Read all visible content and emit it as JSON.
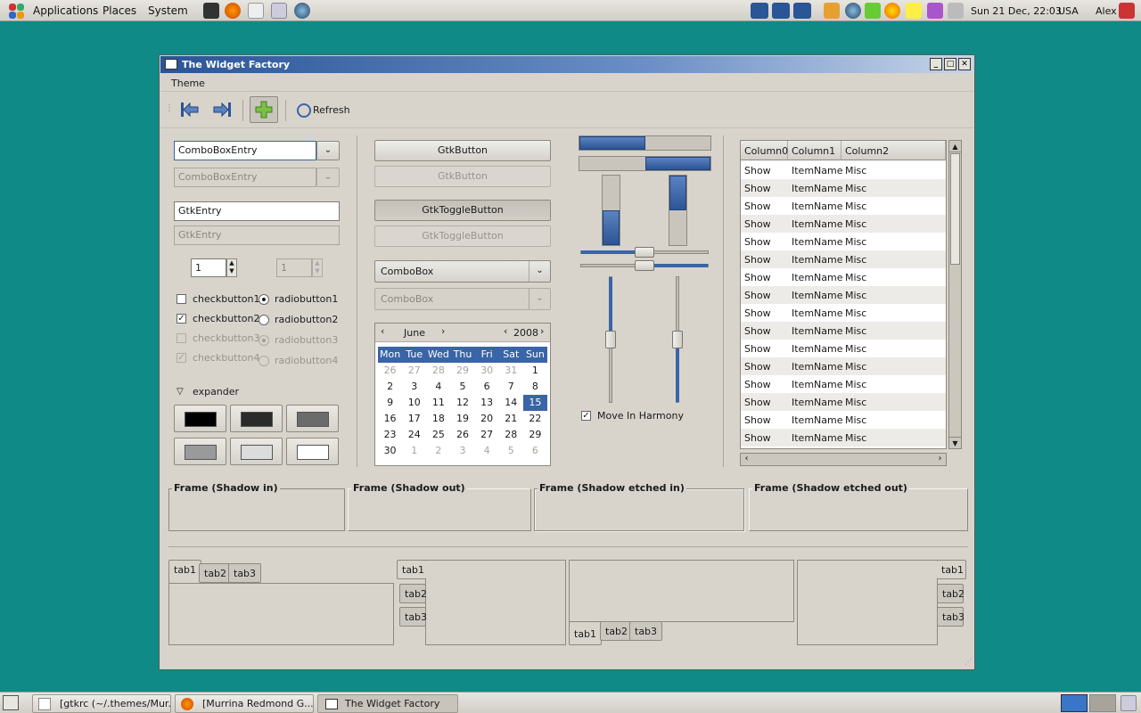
{
  "top_panel": {
    "menus": [
      "Applications",
      "Places",
      "System"
    ],
    "clock": "Sun 21 Dec, 22:03",
    "locale": "USA",
    "user": "Alex"
  },
  "window": {
    "title": "The Widget Factory",
    "menu": "Theme",
    "toolbar": {
      "refresh_label": "Refresh"
    }
  },
  "left": {
    "combo_entry": "ComboBoxEntry",
    "combo_entry_disabled": "ComboBoxEntry",
    "entry": "GtkEntry",
    "entry_disabled": "GtkEntry",
    "spin": "1",
    "spin_disabled": "1",
    "checks": [
      "checkbutton1",
      "checkbutton2",
      "checkbutton3",
      "checkbutton4"
    ],
    "checks_state": [
      false,
      true,
      false,
      true
    ],
    "radios": [
      "radiobutton1",
      "radiobutton2",
      "radiobutton3",
      "radiobutton4"
    ],
    "expander": "expander",
    "swatch_colors": [
      "#000000",
      "#2b2b2b",
      "#6b6b6b",
      "#9a9a9a",
      "#dcdcdc",
      "#ffffff"
    ]
  },
  "middle": {
    "button": "GtkButton",
    "button_disabled": "GtkButton",
    "toggle": "GtkToggleButton",
    "toggle_disabled": "GtkToggleButton",
    "combo": "ComboBox",
    "combo_disabled": "ComboBox",
    "calendar": {
      "month": "June",
      "year": "2008",
      "weekdays": [
        "Mon",
        "Tue",
        "Wed",
        "Thu",
        "Fri",
        "Sat",
        "Sun"
      ],
      "weeks": [
        [
          "26",
          "27",
          "28",
          "29",
          "30",
          "31",
          "1"
        ],
        [
          "2",
          "3",
          "4",
          "5",
          "6",
          "7",
          "8"
        ],
        [
          "9",
          "10",
          "11",
          "12",
          "13",
          "14",
          "15"
        ],
        [
          "16",
          "17",
          "18",
          "19",
          "20",
          "21",
          "22"
        ],
        [
          "23",
          "24",
          "25",
          "26",
          "27",
          "28",
          "29"
        ],
        [
          "30",
          "1",
          "2",
          "3",
          "4",
          "5",
          "6"
        ]
      ],
      "selected": "15"
    }
  },
  "levels": {
    "progress_h1": 0.5,
    "progress_h2": 0.5,
    "progress_v1": 0.5,
    "progress_v2": 0.5,
    "scale_h": 0.5,
    "scale_v": 0.5,
    "harmony_label": "Move In Harmony"
  },
  "tree": {
    "columns": [
      "Column0",
      "Column1",
      "Column2"
    ],
    "rows": [
      [
        "Show",
        "ItemName",
        "Misc"
      ],
      [
        "Show",
        "ItemName",
        "Misc"
      ],
      [
        "Show",
        "ItemName",
        "Misc"
      ],
      [
        "Show",
        "ItemName",
        "Misc"
      ],
      [
        "Show",
        "ItemName",
        "Misc"
      ],
      [
        "Show",
        "ItemName",
        "Misc"
      ],
      [
        "Show",
        "ItemName",
        "Misc"
      ],
      [
        "Show",
        "ItemName",
        "Misc"
      ],
      [
        "Show",
        "ItemName",
        "Misc"
      ],
      [
        "Show",
        "ItemName",
        "Misc"
      ],
      [
        "Show",
        "ItemName",
        "Misc"
      ],
      [
        "Show",
        "ItemName",
        "Misc"
      ],
      [
        "Show",
        "ItemName",
        "Misc"
      ],
      [
        "Show",
        "ItemName",
        "Misc"
      ],
      [
        "Show",
        "ItemName",
        "Misc"
      ],
      [
        "Show",
        "ItemName",
        "Misc"
      ]
    ]
  },
  "frames": [
    "Frame (Shadow in)",
    "Frame (Shadow out)",
    "Frame (Shadow etched in)",
    "Frame (Shadow etched out)"
  ],
  "tabs": [
    "tab1",
    "tab2",
    "tab3"
  ],
  "taskbar": [
    "[gtkrc (~/.themes/Mur...",
    "[Murrina Redmond G...",
    "The Widget Factory"
  ]
}
